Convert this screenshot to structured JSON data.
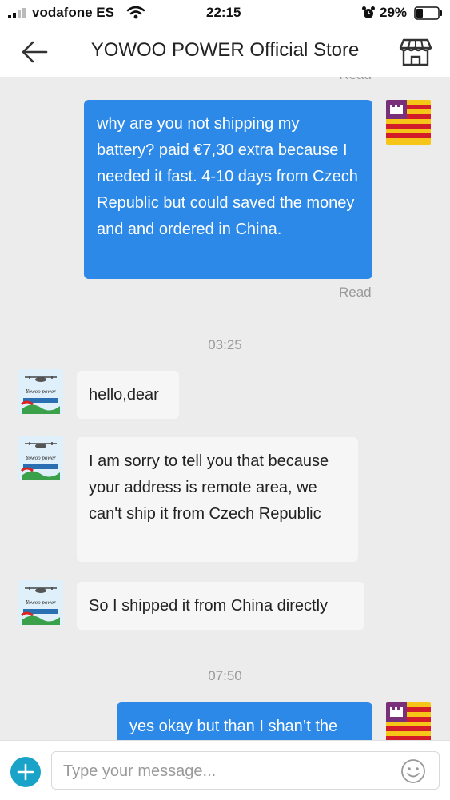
{
  "status_bar": {
    "carrier": "vodafone ES",
    "time": "22:15",
    "battery_percent": "29%"
  },
  "header": {
    "title": "YOWOO POWER Official Store",
    "back_icon": "back-arrow-icon",
    "store_icon": "store-icon"
  },
  "chat": {
    "top_read_label": "Read",
    "messages": [
      {
        "sender": "me",
        "text": "why are you not shipping my battery? paid €7,30 extra because I needed it fast. 4-10 days from Czech Republic but could saved the money and and ordered in China.",
        "status": "Read"
      },
      {
        "type": "timestamp",
        "text": "03:25"
      },
      {
        "sender": "store",
        "text": "hello,dear"
      },
      {
        "sender": "store",
        "text": "I am sorry to tell you that because your address is remote area, we can't ship it from Czech Republic"
      },
      {
        "sender": "store",
        "text": "So I shipped it from China directly"
      },
      {
        "type": "timestamp",
        "text": "07:50"
      },
      {
        "sender": "me",
        "text": "yes okay but than I shan’t the"
      }
    ]
  },
  "input": {
    "placeholder": "Type your message...",
    "value": ""
  },
  "colors": {
    "outgoing_bubble": "#2d89e8",
    "incoming_bubble": "#f6f6f6",
    "chat_background": "#ececec",
    "plus_button": "#1aa3c8"
  }
}
